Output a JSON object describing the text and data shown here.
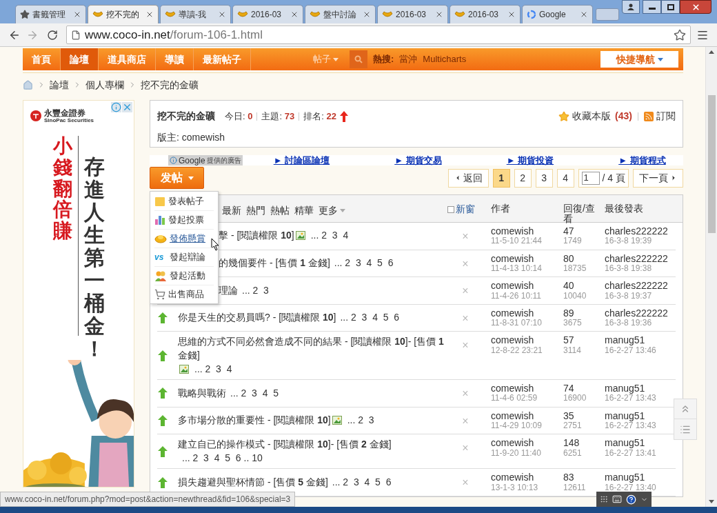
{
  "browser": {
    "tabs": [
      {
        "title": "書籤管理",
        "kind": "bookmarks",
        "selected": false
      },
      {
        "title": "挖不完的",
        "kind": "forum",
        "selected": true
      },
      {
        "title": "導讀-我",
        "kind": "forum",
        "selected": false
      },
      {
        "title": "2016-03",
        "kind": "forum",
        "selected": false
      },
      {
        "title": "盤中討論",
        "kind": "forum",
        "selected": false
      },
      {
        "title": "2016-03",
        "kind": "forum",
        "selected": false
      },
      {
        "title": "2016-03",
        "kind": "forum",
        "selected": false
      },
      {
        "title": "Google",
        "kind": "search",
        "selected": false
      }
    ],
    "url_host": "www.coco-in.net",
    "url_path": "/forum-106-1.html"
  },
  "nav": {
    "items": [
      {
        "label": "首頁",
        "selected": false
      },
      {
        "label": "論壇",
        "selected": true
      },
      {
        "label": "道具商店",
        "selected": false
      },
      {
        "label": "導讀",
        "selected": false
      },
      {
        "label": "最新帖子",
        "selected": false
      }
    ],
    "search_type": "帖子",
    "hot_search_label": "熱搜:",
    "hot_keywords": [
      "當沖",
      "Multicharts"
    ],
    "quick_nav": "快捷導航"
  },
  "breadcrumb": [
    "論壇",
    "個人專欄",
    "挖不完的金礦"
  ],
  "ad": {
    "brand": "永豐金證券",
    "brand_en": "SinoPac Securities",
    "slogan_red": "小錢翻倍賺",
    "slogan": "存進人生第一桶金！"
  },
  "forum": {
    "title": "挖不完的金礦",
    "stats": [
      {
        "label": "今日:",
        "value": "0"
      },
      {
        "label": "主題:",
        "value": "73"
      },
      {
        "label": "排名:",
        "value": "22"
      }
    ],
    "favorite": "收藏本版",
    "favorite_count": "(43)",
    "subscribe": "訂閱",
    "moderator_label": "版主:",
    "moderator": "comewish"
  },
  "google_ads": {
    "badge": "Google",
    "badge_note": "提供的廣告",
    "links": [
      "► 討論區論壇",
      "► 期貨交易",
      "► 期貨投資",
      "► 期貨程式"
    ]
  },
  "post_button": "发帖",
  "post_menu": [
    {
      "label": "發表帖子",
      "kind": "thread",
      "selected": false
    },
    {
      "label": "發起投票",
      "kind": "poll",
      "selected": false
    },
    {
      "label": "發佈懸賞",
      "kind": "reward",
      "selected": true
    },
    {
      "label": "發起辯論",
      "kind": "debate",
      "icon_text": "vs",
      "selected": false
    },
    {
      "label": "發起活動",
      "kind": "activity",
      "selected": false
    },
    {
      "label": "出售商品",
      "kind": "trade",
      "selected": false
    }
  ],
  "pagination": {
    "back": "返回",
    "pages": [
      {
        "label": "1",
        "selected": true
      },
      {
        "label": "2",
        "selected": false
      },
      {
        "label": "3",
        "selected": false
      },
      {
        "label": "4",
        "selected": false
      }
    ],
    "page_input": "1",
    "total": "/ 4 頁",
    "next": "下一頁"
  },
  "table": {
    "filters": [
      "最新",
      "熱門",
      "熱帖",
      "精華",
      "更多"
    ],
    "new_window": {
      "label": "新窗",
      "checked": false
    },
    "columns": [
      "作者",
      "回復/查看",
      "最後發表"
    ],
    "rows": [
      {
        "kind": "covered",
        "title": "擊 - [閱讀權限 **10**]",
        "has_image": true,
        "pages": "... 2  3  4",
        "close": "×",
        "author": "comewish",
        "date": "11-5-10 21:44",
        "replies": "47",
        "views": "1749",
        "last_user": "charles222222",
        "last_date": "16-3-8 19:39"
      },
      {
        "kind": "covered",
        "title": "的幾個要件 - [售價 **1** 金錢]",
        "has_image": false,
        "pages": "... 2  3  4  5  6",
        "close": "×",
        "author": "comewish",
        "date": "11-4-13 10:14",
        "replies": "80",
        "views": "18735",
        "last_user": "charles222222",
        "last_date": "16-3-8 19:38"
      },
      {
        "kind": "covered",
        "title": "理論",
        "has_image": false,
        "pages": "... 2  3",
        "close": "×",
        "author": "comewish",
        "date": "11-4-26 10:11",
        "replies": "40",
        "views": "10040",
        "last_user": "charles222222",
        "last_date": "16-3-8 19:37"
      },
      {
        "kind": "normal",
        "title": "你是天生的交易員嗎? - [閱讀權限 **10**]",
        "has_image": false,
        "pages": "... 2  3  4  5  6",
        "close": "×",
        "author": "comewish",
        "date": "11-8-31 07:10",
        "replies": "89",
        "views": "3675",
        "last_user": "charles222222",
        "last_date": "16-3-8 19:36"
      },
      {
        "kind": "normal",
        "title": "思維的方式不同必然會造成不同的結果 - [閱讀權限 **10**]- [售價 **1** 金錢]",
        "has_image": true,
        "pages": "... 2  3  4",
        "close": "×",
        "author": "comewish",
        "date": "12-8-22 23:21",
        "replies": "57",
        "views": "3114",
        "last_user": "manug51",
        "last_date": "16-2-27 13:46"
      },
      {
        "kind": "normal",
        "title": "戰略與戰術",
        "has_image": false,
        "pages": "... 2  3  4  5",
        "close": "×",
        "author": "comewish",
        "date": "11-4-6 02:59",
        "replies": "74",
        "views": "16900",
        "last_user": "manug51",
        "last_date": "16-2-27 13:43"
      },
      {
        "kind": "normal",
        "title": "多市場分散的重要性 - [閱讀權限 **10**]",
        "has_image": true,
        "pages": "... 2  3",
        "close": "×",
        "author": "comewish",
        "date": "11-4-29 10:09",
        "replies": "35",
        "views": "2751",
        "last_user": "manug51",
        "last_date": "16-2-27 13:43"
      },
      {
        "kind": "normal",
        "title": "建立自已的操作模式 - [閱讀權限 **10**]- [售價 **2** 金錢]",
        "has_image": false,
        "pages": "... 2  3  4  5  6 .. 10",
        "close": "×",
        "author": "comewish",
        "date": "11-9-20 11:40",
        "replies": "148",
        "views": "6251",
        "last_user": "manug51",
        "last_date": "16-2-27 13:41"
      },
      {
        "kind": "normal",
        "title": "損失趨避與聖杯情節 - [售價 **5** 金錢]",
        "has_image": false,
        "pages": "... 2  3  4  5  6",
        "close": "×",
        "author": "comewish",
        "date": "13-1-3 10:13",
        "replies": "83",
        "views": "12611",
        "last_user": "manug51",
        "last_date": "16-2-27 13:40"
      }
    ]
  },
  "status_bar": "www.coco-in.net/forum.php?mod=post&action=newthread&fid=106&special=3"
}
